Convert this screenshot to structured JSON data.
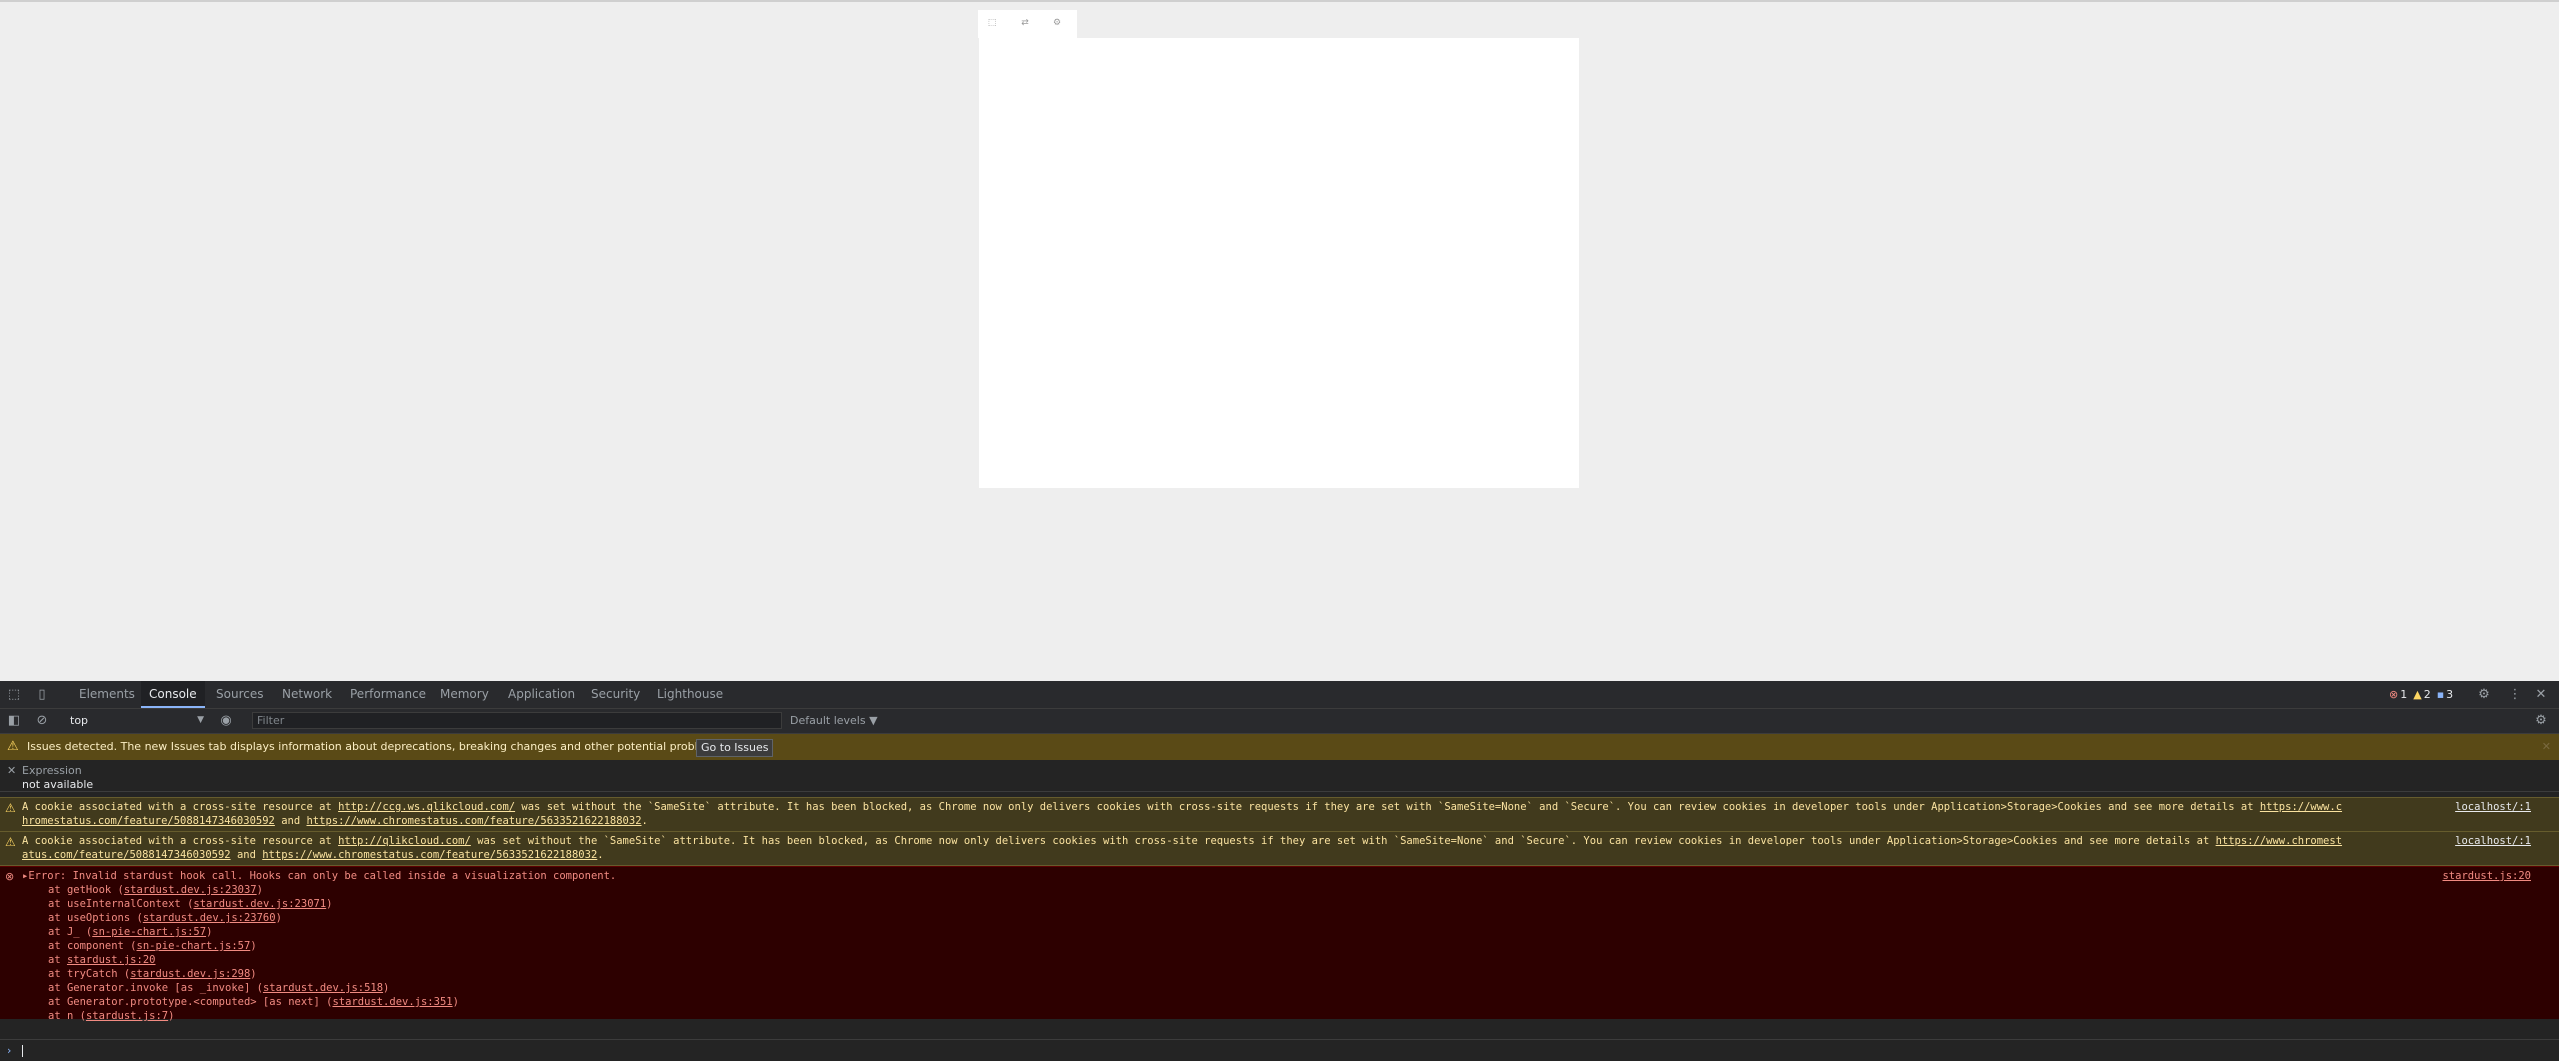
{
  "page": {
    "toolbar_buttons": [
      {
        "icon": "selection-icon",
        "glyph": "⬚"
      },
      {
        "icon": "exploration-icon",
        "glyph": "⇄"
      },
      {
        "icon": "settings-icon",
        "glyph": "⚙"
      }
    ]
  },
  "devtools": {
    "tabs": [
      "Elements",
      "Console",
      "Sources",
      "Network",
      "Performance",
      "Memory",
      "Application",
      "Security",
      "Lighthouse"
    ],
    "active_tab": "Console",
    "counts": {
      "errors": "1",
      "warnings": "2",
      "info": "3"
    },
    "context": "top",
    "filter_placeholder": "Filter",
    "levels_label": "Default levels ▼",
    "issues_banner": "Issues detected. The new Issues tab displays information about deprecations, breaking changes and other potential problems.",
    "go_to_issues": "Go to Issues",
    "expression": {
      "title": "Expression",
      "value": "not available"
    },
    "warnings": [
      {
        "line1_prefix": "A cookie associated with a cross-site resource at ",
        "line1_link": "http://ccg.ws.qlikcloud.com/",
        "line1_suffix": " was set without the `SameSite` attribute. It has been blocked, as Chrome now only delivers cookies with cross-site requests if they are set with `SameSite=None` and `Secure`. You can review cookies in developer tools under Application>Storage>Cookies and see more details at ",
        "line1_link2": "https://www.c",
        "line2_link1": "hromestatus.com/feature/5088147346030592",
        "line2_mid": " and ",
        "line2_link2": "https://www.chromestatus.com/feature/5633521622188032",
        "line2_end": ".",
        "source1": "localhost/:1"
      },
      {
        "line1_prefix": "A cookie associated with a cross-site resource at ",
        "line1_link": "http://qlikcloud.com/",
        "line1_suffix": " was set without the `SameSite` attribute. It has been blocked, as Chrome now only delivers cookies with cross-site requests if they are set with `SameSite=None` and `Secure`. You can review cookies in developer tools under Application>Storage>Cookies and see more details at ",
        "line1_link2": "https://www.chromest",
        "line2_link1": "atus.com/feature/5088147346030592",
        "line2_mid": " and ",
        "line2_link2": "https://www.chromestatus.com/feature/5633521622188032",
        "line2_end": ".",
        "source1": "localhost/:1"
      }
    ],
    "error": {
      "message": "▸Error: Invalid stardust hook call. Hooks can only be called inside a visualization component.",
      "source": "stardust.js:20",
      "stack": [
        {
          "text": "at getHook (",
          "loc": "stardust.dev.js:23037",
          "end": ")"
        },
        {
          "text": "at useInternalContext (",
          "loc": "stardust.dev.js:23071",
          "end": ")"
        },
        {
          "text": "at useOptions (",
          "loc": "stardust.dev.js:23760",
          "end": ")"
        },
        {
          "text": "at J_ (",
          "loc": "sn-pie-chart.js:57",
          "end": ")"
        },
        {
          "text": "at component (",
          "loc": "sn-pie-chart.js:57",
          "end": ")"
        },
        {
          "text": "at ",
          "loc": "stardust.js:20",
          "end": ""
        },
        {
          "text": "at tryCatch (",
          "loc": "stardust.dev.js:298",
          "end": ")"
        },
        {
          "text": "at Generator.invoke [as _invoke] (",
          "loc": "stardust.dev.js:518",
          "end": ")"
        },
        {
          "text": "at Generator.prototype.<computed> [as next] (",
          "loc": "stardust.dev.js:351",
          "end": ")"
        },
        {
          "text": "at n (",
          "loc": "stardust.js:7",
          "end": ")"
        }
      ]
    }
  }
}
